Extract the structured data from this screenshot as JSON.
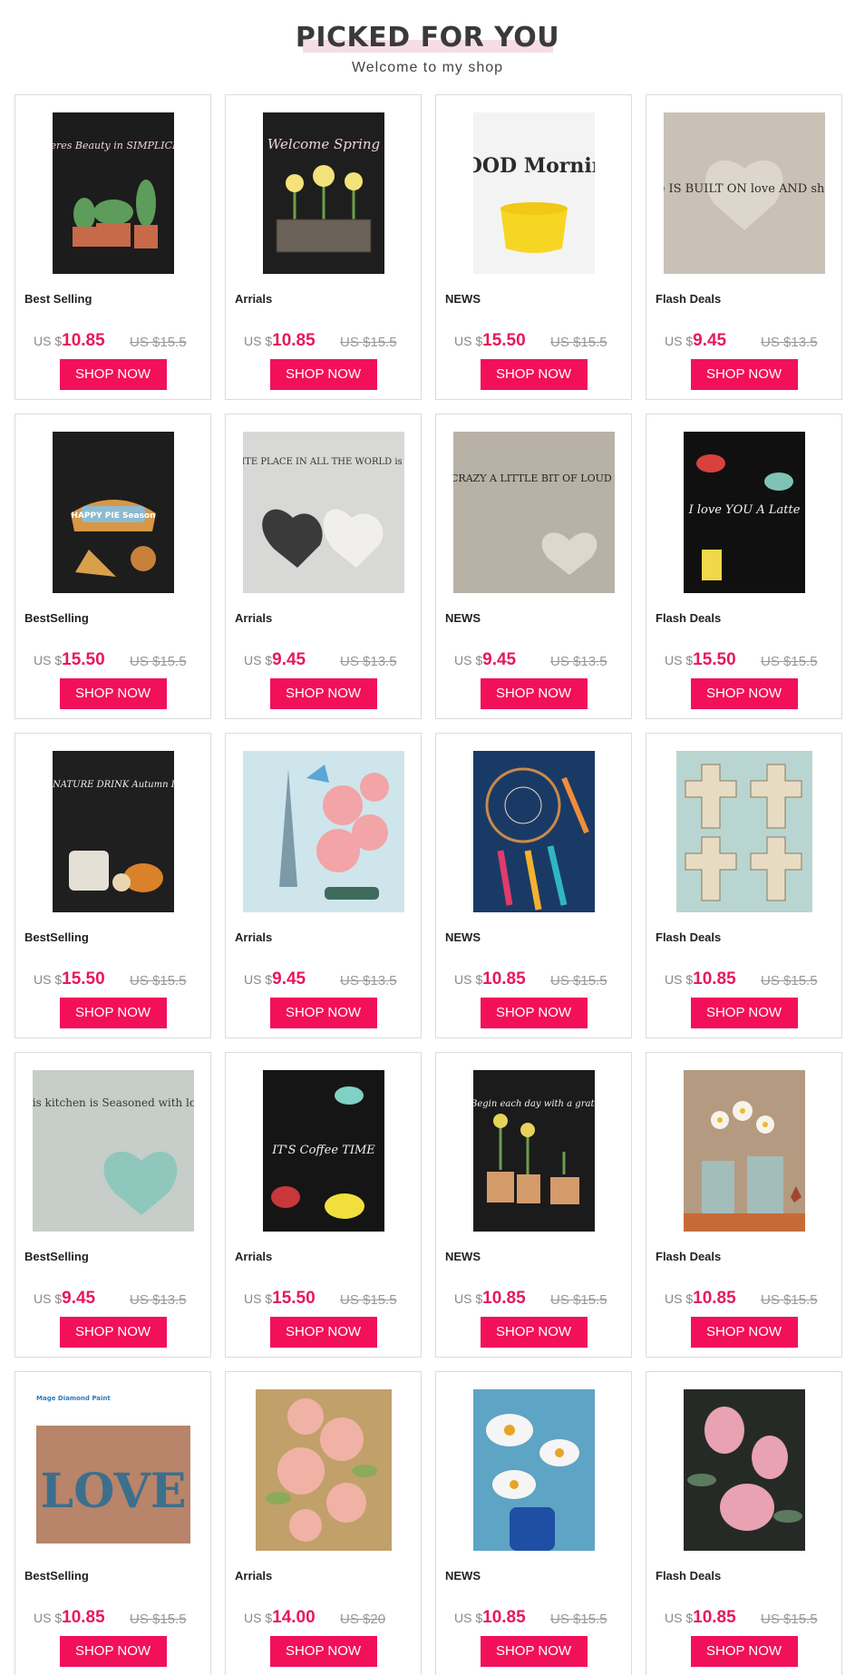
{
  "header": {
    "title": "PICKED FOR YOU",
    "subtitle": "Welcome to my shop"
  },
  "colors": {
    "accent": "#f2105a",
    "price": "#e8185a",
    "title_highlight": "#f6dde4"
  },
  "shop_label": "SHOP NOW",
  "currency": "US $",
  "products": [
    {
      "category": "Best Selling",
      "price": "10.85",
      "old_price": "US $15.5",
      "art": "chalkboard-cactus",
      "text": "Theres Beauty in SIMPLICITY"
    },
    {
      "category": "Arrials",
      "price": "10.85",
      "old_price": "US $15.5",
      "art": "chalkboard-spring",
      "text": "Welcome Spring"
    },
    {
      "category": "NEWS",
      "price": "15.50",
      "old_price": "US $15.5",
      "art": "good-morning",
      "text": "GOOD Morning"
    },
    {
      "category": "Flash Deals",
      "price": "9.45",
      "old_price": "US $13.5",
      "art": "home-shenanigans",
      "text": "This home IS BUILT ON love AND shenanigans"
    },
    {
      "category": "BestSelling",
      "price": "15.50",
      "old_price": "US $15.5",
      "art": "chalkboard-pie",
      "text": "HAPPY PIE Season"
    },
    {
      "category": "Arrials",
      "price": "9.45",
      "old_price": "US $13.5",
      "art": "favorite-place",
      "text": "MY FAVORITE PLACE IN ALL THE WORLD is next to you"
    },
    {
      "category": "NEWS",
      "price": "9.45",
      "old_price": "US $13.5",
      "art": "family",
      "text": "Family A LITTLE BIT OF CRAZY A LITTLE BIT OF LOUD & A WHOLE LOT OF love"
    },
    {
      "category": "Flash Deals",
      "price": "15.50",
      "old_price": "US $15.5",
      "art": "love-latte",
      "text": "I love YOU A Latte"
    },
    {
      "category": "BestSelling",
      "price": "15.50",
      "old_price": "US $15.5",
      "art": "autumn-mug",
      "text": "OUR SIGNATURE DRINK Autumn IN A Mug"
    },
    {
      "category": "Arrials",
      "price": "9.45",
      "old_price": "US $13.5",
      "art": "paris-roses",
      "text": ""
    },
    {
      "category": "NEWS",
      "price": "10.85",
      "old_price": "US $15.5",
      "art": "dreamcatcher",
      "text": ""
    },
    {
      "category": "Flash Deals",
      "price": "10.85",
      "old_price": "US $15.5",
      "art": "crosses",
      "text": ""
    },
    {
      "category": "BestSelling",
      "price": "9.45",
      "old_price": "US $13.5",
      "art": "kitchen-seasoned",
      "text": "This kitchen is Seasoned with love"
    },
    {
      "category": "Arrials",
      "price": "15.50",
      "old_price": "US $15.5",
      "art": "coffee-time",
      "text": "IT'S Coffee TIME"
    },
    {
      "category": "NEWS",
      "price": "10.85",
      "old_price": "US $15.5",
      "art": "grateful-heart",
      "text": "Begin each day with a grateful heart"
    },
    {
      "category": "Flash Deals",
      "price": "10.85",
      "old_price": "US $15.5",
      "art": "daisy-jars",
      "text": ""
    },
    {
      "category": "BestSelling",
      "price": "10.85",
      "old_price": "US $15.5",
      "art": "love-letters",
      "text": "LOVE",
      "brand": "Mage Diamond Paint"
    },
    {
      "category": "Arrials",
      "price": "14.00",
      "old_price": "US $20",
      "art": "peonies",
      "text": ""
    },
    {
      "category": "NEWS",
      "price": "10.85",
      "old_price": "US $15.5",
      "art": "daisies-vase",
      "text": ""
    },
    {
      "category": "Flash Deals",
      "price": "10.85",
      "old_price": "US $15.5",
      "art": "protea",
      "text": ""
    }
  ]
}
